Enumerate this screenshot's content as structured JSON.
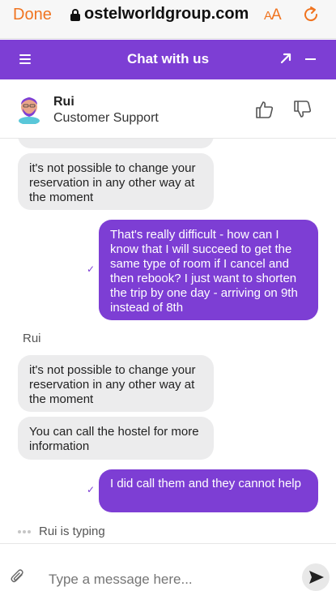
{
  "browser": {
    "done_label": "Done",
    "url": "ostelworldgroup.com",
    "text_size_label": "AA"
  },
  "chat": {
    "title": "Chat with us"
  },
  "agent": {
    "name": "Rui",
    "role": "Customer Support"
  },
  "messages": [
    {
      "id": "m1",
      "direction": "in",
      "text": "it's not possible to change your reservation in any other way at the moment"
    },
    {
      "id": "m2",
      "direction": "out",
      "text": "That's really difficult - how can I know that I will succeed to get the same type of room if I cancel and then rebook? I just want to shorten the trip by one day - arriving on 9th instead of 8th"
    },
    {
      "id": "m3",
      "direction": "in",
      "sender": "Rui",
      "text": "it's not possible to change your reservation in any other way at the moment"
    },
    {
      "id": "m4",
      "direction": "in",
      "text": "You can call the hostel for more information"
    },
    {
      "id": "m5",
      "direction": "out",
      "text": "I did call them and they cannot help"
    }
  ],
  "typing_indicator": "Rui is typing",
  "composer": {
    "placeholder": "Type a message here..."
  },
  "colors": {
    "brand_purple": "#7d3ed4",
    "ios_orange": "#f07420",
    "incoming_bubble": "#ececed"
  }
}
